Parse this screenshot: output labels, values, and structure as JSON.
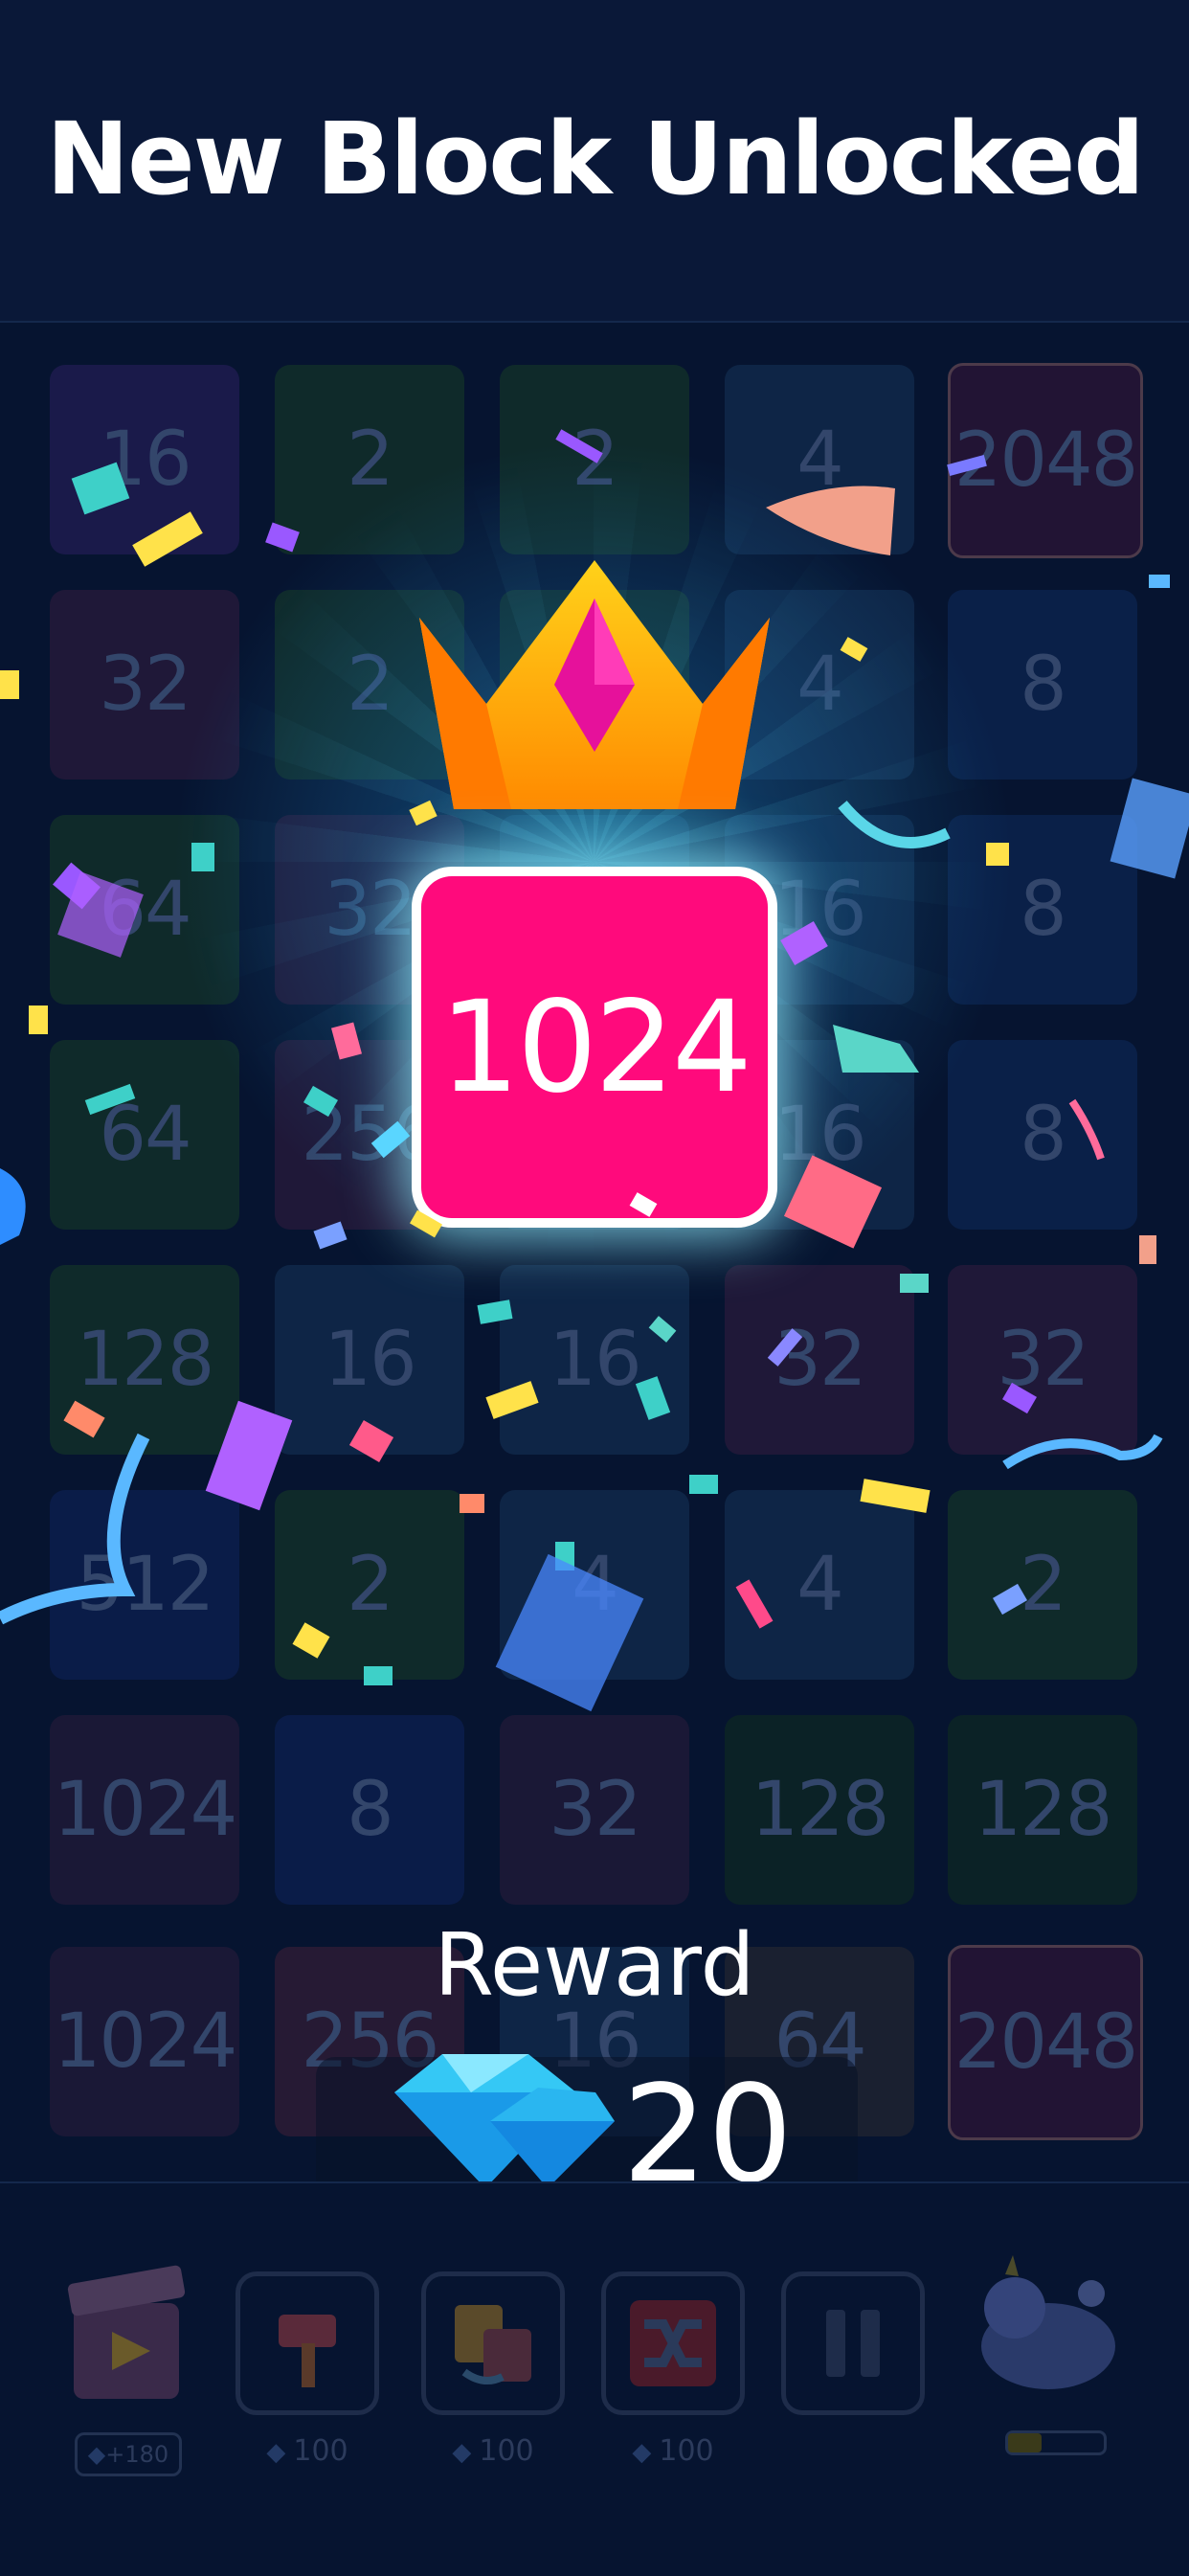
{
  "header": {
    "title": "New Block Unlocked"
  },
  "board": {
    "rows": [
      [
        "16",
        "2",
        "2",
        "4",
        "2048"
      ],
      [
        "32",
        "2",
        "",
        "4",
        "8"
      ],
      [
        "64",
        "32",
        "",
        "16",
        "8"
      ],
      [
        "64",
        "256",
        "",
        "16",
        "8"
      ],
      [
        "128",
        "16",
        "16",
        "32",
        "32"
      ],
      [
        "512",
        "2",
        "4",
        "4",
        "2"
      ],
      [
        "1024",
        "8",
        "32",
        "128",
        "128"
      ],
      [
        "1024",
        "256",
        "16",
        "64",
        "2048"
      ]
    ],
    "highlight_tile": "1024"
  },
  "reward": {
    "label": "Reward",
    "amount": "20",
    "icon": "diamond-icon"
  },
  "toolbar": {
    "items": [
      {
        "name": "video-ad",
        "icon": "clapperboard-icon",
        "badge": "+180"
      },
      {
        "name": "hammer",
        "icon": "hammer-icon",
        "cost": "100"
      },
      {
        "name": "swap",
        "icon": "swap-icon",
        "cost": "100"
      },
      {
        "name": "shuffle",
        "icon": "shuffle-icon",
        "cost": "100"
      },
      {
        "name": "pause",
        "icon": "pause-icon"
      },
      {
        "name": "mascot",
        "icon": "unicorn-icon",
        "progress": 0.35
      }
    ]
  },
  "colors": {
    "accent_tile": "#ff0a7c",
    "background": "#061430",
    "glow": "#3cc8f0",
    "gem": "#35c8f5"
  }
}
